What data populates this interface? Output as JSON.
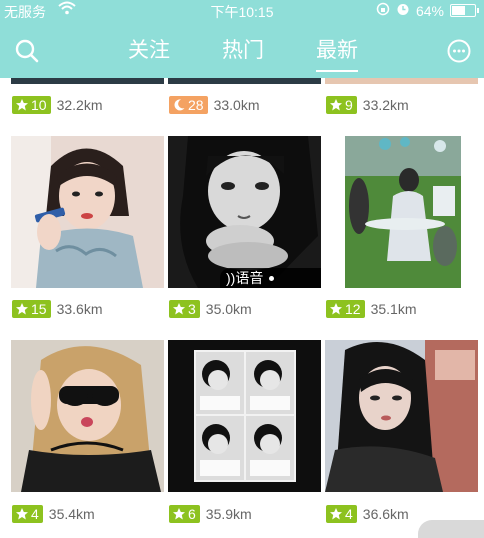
{
  "status": {
    "carrier": "无服务",
    "time": "下午10:15",
    "battery": "64%",
    "battery_level": 0.64
  },
  "nav": {
    "tabs": [
      {
        "label": "关注",
        "active": false
      },
      {
        "label": "热门",
        "active": false
      },
      {
        "label": "最新",
        "active": true
      }
    ],
    "left_icon": "search-icon",
    "right_icon": "message-icon"
  },
  "colors": {
    "header": "#8fded8",
    "star_badge": "#8dc21f",
    "moon_badge": "#f4a262"
  },
  "rows": [
    {
      "cards": [
        {
          "badge_icon": "star-icon",
          "count": "10",
          "distance": "32.2km"
        },
        {
          "badge_icon": "moon-icon",
          "count": "28",
          "distance": "33.0km"
        },
        {
          "badge_icon": "star-icon",
          "count": "9",
          "distance": "33.2km"
        }
      ]
    },
    {
      "cards": [
        {
          "badge_icon": "star-icon",
          "count": "15",
          "distance": "33.6km"
        },
        {
          "badge_icon": "star-icon",
          "count": "3",
          "distance": "35.0km",
          "voice_label": "))语音"
        },
        {
          "badge_icon": "star-icon",
          "count": "12",
          "distance": "35.1km"
        }
      ]
    },
    {
      "cards": [
        {
          "badge_icon": "star-icon",
          "count": "4",
          "distance": "35.4km"
        },
        {
          "badge_icon": "star-icon",
          "count": "6",
          "distance": "35.9km"
        },
        {
          "badge_icon": "star-icon",
          "count": "4",
          "distance": "36.6km"
        }
      ]
    }
  ]
}
